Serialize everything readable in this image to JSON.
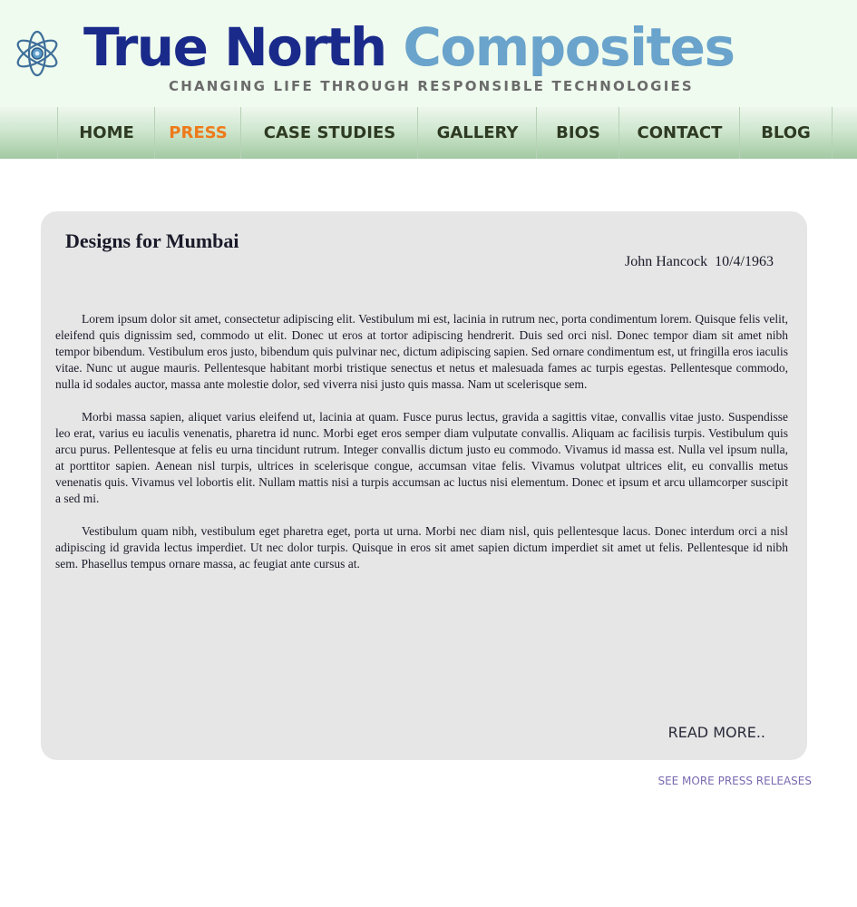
{
  "header": {
    "logo_icon": "atom-icon",
    "brand_part1": "True North",
    "brand_part2": "Composites",
    "tagline": "CHANGING LIFE THROUGH RESPONSIBLE TECHNOLOGIES",
    "colors": {
      "brand_dark": "#1a2a8a",
      "brand_light": "#6aa3cb",
      "background": "#effbee"
    }
  },
  "nav": {
    "items": [
      {
        "label": "HOME",
        "active": false
      },
      {
        "label": "PRESS",
        "active": true
      },
      {
        "label": "CASE STUDIES",
        "active": false
      },
      {
        "label": "GALLERY",
        "active": false
      },
      {
        "label": "BIOS",
        "active": false
      },
      {
        "label": "CONTACT",
        "active": false
      },
      {
        "label": "BLOG",
        "active": false
      }
    ],
    "colors": {
      "text": "#2e3a22",
      "active": "#ee7a1a"
    }
  },
  "article": {
    "title": "Designs for Mumbai",
    "byline": "John Hancock  10/4/1963",
    "paragraphs": [
      "Lorem ipsum dolor sit amet, consectetur adipiscing elit. Vestibulum mi est, lacinia in rutrum nec, porta condimentum lorem. Quisque felis velit, eleifend quis dignissim sed, commodo ut elit. Donec ut eros at tortor adipiscing hendrerit. Duis sed orci nisl. Donec tempor diam sit amet nibh tempor bibendum. Vestibulum eros justo, bibendum quis pulvinar nec, dictum adipiscing sapien. Sed ornare condimentum est, ut fringilla eros iaculis vitae. Nunc ut augue mauris. Pellentesque habitant morbi tristique senectus et netus et malesuada fames ac turpis egestas. Pellentesque commodo, nulla id sodales auctor, massa ante molestie dolor, sed viverra nisi justo quis massa. Nam ut scelerisque sem.",
      "Morbi massa sapien, aliquet varius eleifend ut, lacinia at quam. Fusce purus lectus, gravida a sagittis vitae, convallis vitae justo. Suspendisse leo erat, varius eu iaculis venenatis, pharetra id nunc. Morbi eget eros semper diam vulputate convallis. Aliquam ac facilisis turpis. Vestibulum quis arcu purus. Pellentesque at felis eu urna tincidunt rutrum. Integer convallis dictum justo eu commodo. Vivamus id massa est. Nulla vel ipsum nulla, at porttitor sapien. Aenean nisl turpis, ultrices in scelerisque congue, accumsan vitae felis. Vivamus volutpat ultrices elit, eu convallis metus venenatis quis. Vivamus vel lobortis elit. Nullam mattis nisi a turpis accumsan ac luctus nisi elementum. Donec et ipsum et arcu ullamcorper suscipit a sed mi.",
      "Vestibulum quam nibh, vestibulum eget pharetra eget, porta ut urna. Morbi nec diam nisl, quis pellentesque lacus. Donec interdum orci a nisl adipiscing id gravida lectus imperdiet. Ut nec dolor turpis. Quisque in eros sit amet sapien dictum imperdiet sit amet ut felis. Pellentesque id nibh sem. Phasellus tempus ornare massa, ac feugiat ante cursus at."
    ],
    "read_more": "READ MORE.."
  },
  "footer": {
    "see_more": "SEE MORE PRESS RELEASES"
  }
}
